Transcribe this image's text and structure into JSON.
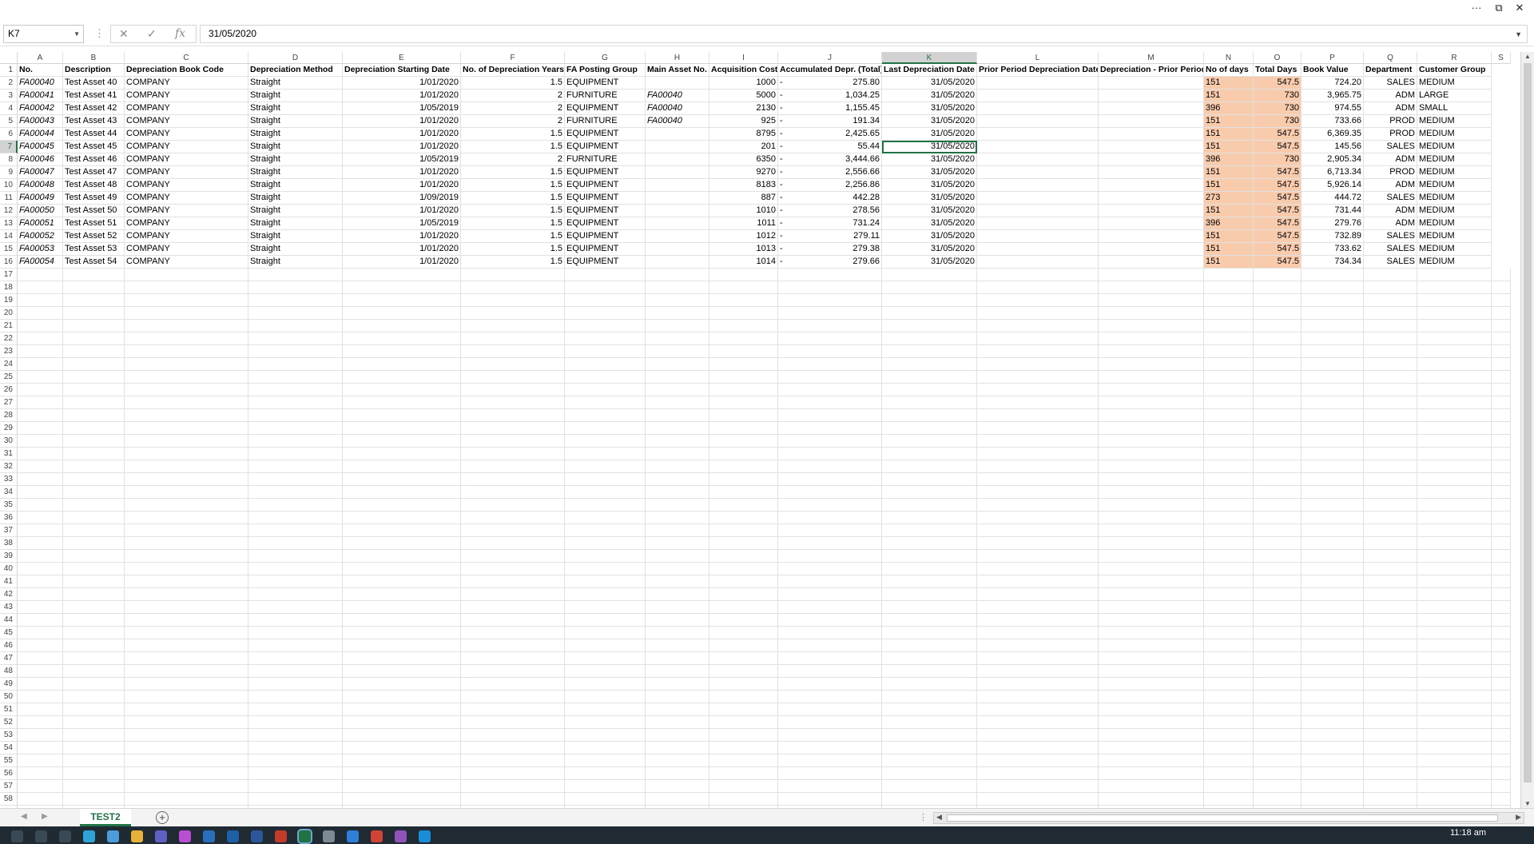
{
  "window": {
    "more_glyph": "···",
    "restore_glyph": "⧉",
    "close_glyph": "✕"
  },
  "formula_bar": {
    "name_box": "K7",
    "formula": "31/05/2020",
    "cancel_glyph": "✕",
    "enter_glyph": "✓",
    "fx_glyph": "fx"
  },
  "columns": [
    "A",
    "B",
    "C",
    "D",
    "E",
    "F",
    "G",
    "H",
    "I",
    "J",
    "K",
    "L",
    "M",
    "N",
    "O",
    "P",
    "Q",
    "R",
    "S"
  ],
  "selected_column": "K",
  "selected_row": 7,
  "headers": [
    "No.",
    "Description",
    "Depreciation Book Code",
    "Depreciation Method",
    "Depreciation Starting Date",
    "No. of Depreciation Years",
    "FA Posting Group",
    "Main Asset No.",
    "Acquisition Cost",
    "Accumulated Depr. (Total)",
    "Last Depreciation Date",
    "Prior Period Depreciation Date",
    "Depreciation - Prior Period",
    "No of days",
    "Total Days",
    "Book Value",
    "Department",
    "Customer Group"
  ],
  "rows": [
    [
      "FA00040",
      "Test Asset 40",
      "COMPANY",
      "Straight",
      "1/01/2020",
      "1.5",
      "EQUIPMENT",
      "",
      "1000",
      "-",
      "275.80",
      "31/05/2020",
      "",
      "",
      "151",
      "547.5",
      "724.20",
      "SALES",
      "MEDIUM"
    ],
    [
      "FA00041",
      "Test Asset 41",
      "COMPANY",
      "Straight",
      "1/01/2020",
      "2",
      "FURNITURE",
      "FA00040",
      "5000",
      "-",
      "1,034.25",
      "31/05/2020",
      "",
      "",
      "151",
      "730",
      "3,965.75",
      "ADM",
      "LARGE"
    ],
    [
      "FA00042",
      "Test Asset 42",
      "COMPANY",
      "Straight",
      "1/05/2019",
      "2",
      "EQUIPMENT",
      "FA00040",
      "2130",
      "-",
      "1,155.45",
      "31/05/2020",
      "",
      "",
      "396",
      "730",
      "974.55",
      "ADM",
      "SMALL"
    ],
    [
      "FA00043",
      "Test Asset 43",
      "COMPANY",
      "Straight",
      "1/01/2020",
      "2",
      "FURNITURE",
      "FA00040",
      "925",
      "-",
      "191.34",
      "31/05/2020",
      "",
      "",
      "151",
      "730",
      "733.66",
      "PROD",
      "MEDIUM"
    ],
    [
      "FA00044",
      "Test Asset 44",
      "COMPANY",
      "Straight",
      "1/01/2020",
      "1.5",
      "EQUIPMENT",
      "",
      "8795",
      "-",
      "2,425.65",
      "31/05/2020",
      "",
      "",
      "151",
      "547.5",
      "6,369.35",
      "PROD",
      "MEDIUM"
    ],
    [
      "FA00045",
      "Test Asset 45",
      "COMPANY",
      "Straight",
      "1/01/2020",
      "1.5",
      "EQUIPMENT",
      "",
      "201",
      "-",
      "55.44",
      "31/05/2020",
      "",
      "",
      "151",
      "547.5",
      "145.56",
      "SALES",
      "MEDIUM"
    ],
    [
      "FA00046",
      "Test Asset 46",
      "COMPANY",
      "Straight",
      "1/05/2019",
      "2",
      "FURNITURE",
      "",
      "6350",
      "-",
      "3,444.66",
      "31/05/2020",
      "",
      "",
      "396",
      "730",
      "2,905.34",
      "ADM",
      "MEDIUM"
    ],
    [
      "FA00047",
      "Test Asset 47",
      "COMPANY",
      "Straight",
      "1/01/2020",
      "1.5",
      "EQUIPMENT",
      "",
      "9270",
      "-",
      "2,556.66",
      "31/05/2020",
      "",
      "",
      "151",
      "547.5",
      "6,713.34",
      "PROD",
      "MEDIUM"
    ],
    [
      "FA00048",
      "Test Asset 48",
      "COMPANY",
      "Straight",
      "1/01/2020",
      "1.5",
      "EQUIPMENT",
      "",
      "8183",
      "-",
      "2,256.86",
      "31/05/2020",
      "",
      "",
      "151",
      "547.5",
      "5,926.14",
      "ADM",
      "MEDIUM"
    ],
    [
      "FA00049",
      "Test Asset 49",
      "COMPANY",
      "Straight",
      "1/09/2019",
      "1.5",
      "EQUIPMENT",
      "",
      "887",
      "-",
      "442.28",
      "31/05/2020",
      "",
      "",
      "273",
      "547.5",
      "444.72",
      "SALES",
      "MEDIUM"
    ],
    [
      "FA00050",
      "Test Asset 50",
      "COMPANY",
      "Straight",
      "1/01/2020",
      "1.5",
      "EQUIPMENT",
      "",
      "1010",
      "-",
      "278.56",
      "31/05/2020",
      "",
      "",
      "151",
      "547.5",
      "731.44",
      "ADM",
      "MEDIUM"
    ],
    [
      "FA00051",
      "Test Asset 51",
      "COMPANY",
      "Straight",
      "1/05/2019",
      "1.5",
      "EQUIPMENT",
      "",
      "1011",
      "-",
      "731.24",
      "31/05/2020",
      "",
      "",
      "396",
      "547.5",
      "279.76",
      "ADM",
      "MEDIUM"
    ],
    [
      "FA00052",
      "Test Asset 52",
      "COMPANY",
      "Straight",
      "1/01/2020",
      "1.5",
      "EQUIPMENT",
      "",
      "1012",
      "-",
      "279.11",
      "31/05/2020",
      "",
      "",
      "151",
      "547.5",
      "732.89",
      "SALES",
      "MEDIUM"
    ],
    [
      "FA00053",
      "Test Asset 53",
      "COMPANY",
      "Straight",
      "1/01/2020",
      "1.5",
      "EQUIPMENT",
      "",
      "1013",
      "-",
      "279.38",
      "31/05/2020",
      "",
      "",
      "151",
      "547.5",
      "733.62",
      "SALES",
      "MEDIUM"
    ],
    [
      "FA00054",
      "Test Asset 54",
      "COMPANY",
      "Straight",
      "1/01/2020",
      "1.5",
      "EQUIPMENT",
      "",
      "1014",
      "-",
      "279.66",
      "31/05/2020",
      "",
      "",
      "151",
      "547.5",
      "734.34",
      "SALES",
      "MEDIUM"
    ]
  ],
  "total_rows": 61,
  "sheet": {
    "tab_label": "TEST2",
    "add_glyph": "+",
    "prev_glyph": "◀",
    "next_glyph": "▶"
  },
  "taskbar": {
    "clock": "11:18 am"
  },
  "colors": {
    "accent": "#217346",
    "highlight": "#f8cbad"
  }
}
